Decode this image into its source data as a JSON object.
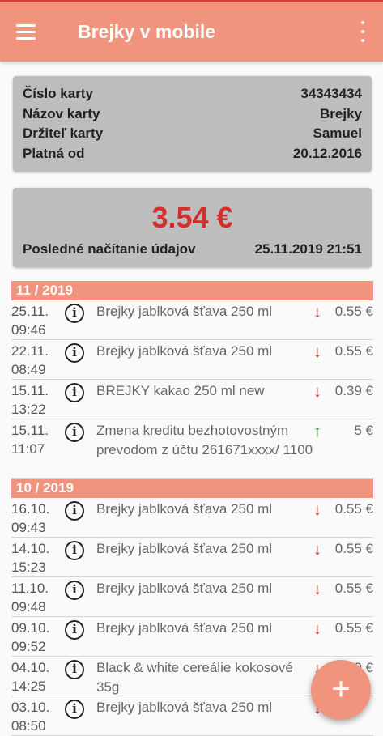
{
  "app": {
    "title": "Brejky v mobile"
  },
  "card": {
    "rows": [
      {
        "label": "Číslo karty",
        "value": "34343434"
      },
      {
        "label": "Názov karty",
        "value": "Brejky"
      },
      {
        "label": "Držiteľ karty",
        "value": "Samuel"
      },
      {
        "label": "Platná od",
        "value": "20.12.2016"
      }
    ]
  },
  "balance": {
    "amount": "3.54 €",
    "last_read_label": "Posledné načítanie údajov",
    "last_read_value": "25.11.2019 21:51"
  },
  "months": [
    {
      "label": "11 / 2019",
      "transactions": [
        {
          "date": "25.11.",
          "time": "09:46",
          "desc": "Brejky jablková šťava 250 ml",
          "direction": "down",
          "amount": "0.55 €"
        },
        {
          "date": "22.11.",
          "time": "08:49",
          "desc": "Brejky jablková šťava 250 ml",
          "direction": "down",
          "amount": "0.55 €"
        },
        {
          "date": "15.11.",
          "time": "13:22",
          "desc": "BREJKY kakao 250 ml new",
          "direction": "down",
          "amount": "0.39 €"
        },
        {
          "date": "15.11.",
          "time": "11:07",
          "desc": "Zmena kreditu bezhotovostným prevodom z účtu 261671xxxx/ 1100",
          "direction": "up",
          "amount": "5 €"
        }
      ]
    },
    {
      "label": "10 / 2019",
      "transactions": [
        {
          "date": "16.10.",
          "time": "09:43",
          "desc": "Brejky jablková šťava 250 ml",
          "direction": "down",
          "amount": "0.55 €"
        },
        {
          "date": "14.10.",
          "time": "15:23",
          "desc": "Brejky jablková šťava 250 ml",
          "direction": "down",
          "amount": "0.55 €"
        },
        {
          "date": "11.10.",
          "time": "09:48",
          "desc": "Brejky jablková šťava 250 ml",
          "direction": "down",
          "amount": "0.55 €"
        },
        {
          "date": "09.10.",
          "time": "09:52",
          "desc": "Brejky jablková šťava 250 ml",
          "direction": "down",
          "amount": "0.55 €"
        },
        {
          "date": "04.10.",
          "time": "14:25",
          "desc": "Black & white cereálie kokosové 35g",
          "direction": "down",
          "amount": "0.40 €"
        },
        {
          "date": "03.10.",
          "time": "08:50",
          "desc": "Brejky jablková šťava 250 ml",
          "direction": "down",
          "amount": ""
        }
      ]
    }
  ],
  "icons": {
    "menu": "hamburger-menu-icon",
    "more": "more-vertical-icon",
    "info": "info-circle-icon",
    "fab": "plus-icon"
  },
  "colors": {
    "accent": "#f0947e",
    "amount": "#d32f2f",
    "debit": "#c62828",
    "credit": "#2e7d32"
  }
}
